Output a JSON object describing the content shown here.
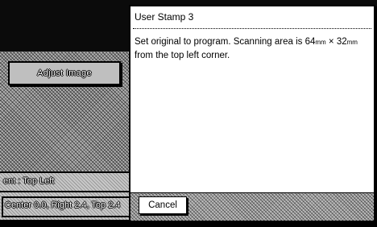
{
  "background": {
    "adjust_image_label": "Adjust Image",
    "position_text": "ent : Top Left",
    "offset_text": "Center 0.0, Right 2.4, Top 2.4"
  },
  "dialog": {
    "title": "User Stamp 3",
    "message_part1": "Set original to program. Scanning area is 64",
    "unit1": "mm",
    "times": " × 32",
    "unit2": "mm",
    "message_part2": "from the top left corner.",
    "cancel_label": "Cancel"
  }
}
